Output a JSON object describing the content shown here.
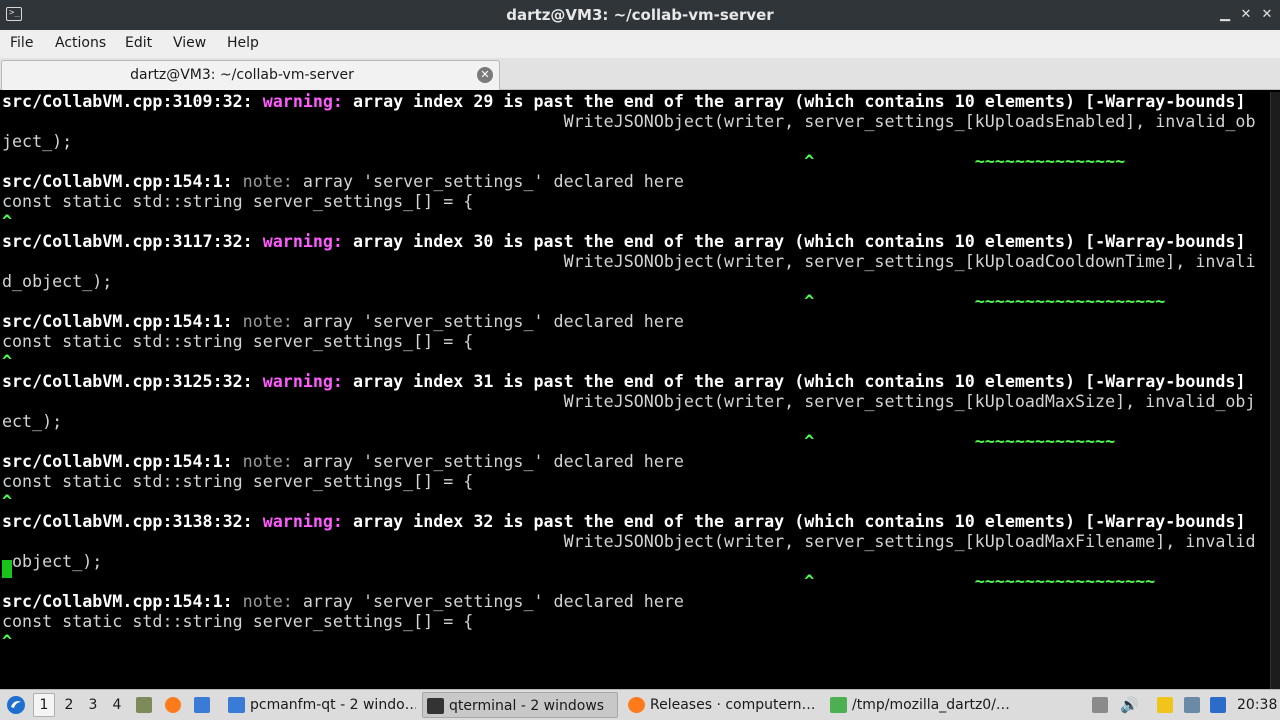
{
  "window": {
    "title": "dartz@VM3: ~/collab-vm-server",
    "app_icon": "terminal-icon",
    "controls": {
      "minimize": "–",
      "maximize": "✕",
      "close": "✕"
    }
  },
  "menu": {
    "file": "File",
    "actions": "Actions",
    "edit": "Edit",
    "view": "View",
    "help": "Help"
  },
  "tab": {
    "label": "dartz@VM3: ~/collab-vm-server",
    "close_glyph": "✕"
  },
  "terminal": {
    "lines": [
      {
        "segments": [
          {
            "c": "b",
            "t": "src/CollabVM.cpp:3109:32: "
          },
          {
            "c": "w",
            "t": "warning: "
          },
          {
            "c": "b",
            "t": "array index 29 is past the end of the array (which contains 10 elements) [-Warray-bounds]"
          }
        ]
      },
      {
        "segments": [
          {
            "c": "",
            "t": "                                                        WriteJSONObject(writer, server_settings_[kUploadsEnabled], invalid_ob"
          }
        ]
      },
      {
        "segments": [
          {
            "c": "",
            "t": "ject_);"
          }
        ]
      },
      {
        "segments": [
          {
            "c": "g",
            "t": "                                                                                ^                ~~~~~~~~~~~~~~~"
          }
        ]
      },
      {
        "segments": [
          {
            "c": "b",
            "t": "src/CollabVM.cpp:154:1: "
          },
          {
            "c": "n",
            "t": "note: "
          },
          {
            "c": "",
            "t": "array 'server_settings_' declared here"
          }
        ]
      },
      {
        "segments": [
          {
            "c": "",
            "t": "const static std::string server_settings_[] = {"
          }
        ]
      },
      {
        "segments": [
          {
            "c": "g",
            "t": "^"
          }
        ]
      },
      {
        "segments": [
          {
            "c": "b",
            "t": "src/CollabVM.cpp:3117:32: "
          },
          {
            "c": "w",
            "t": "warning: "
          },
          {
            "c": "b",
            "t": "array index 30 is past the end of the array (which contains 10 elements) [-Warray-bounds]"
          }
        ]
      },
      {
        "segments": [
          {
            "c": "",
            "t": "                                                        WriteJSONObject(writer, server_settings_[kUploadCooldownTime], invali"
          }
        ]
      },
      {
        "segments": [
          {
            "c": "",
            "t": "d_object_);"
          }
        ]
      },
      {
        "segments": [
          {
            "c": "g",
            "t": "                                                                                ^                ~~~~~~~~~~~~~~~~~~~"
          }
        ]
      },
      {
        "segments": [
          {
            "c": "b",
            "t": "src/CollabVM.cpp:154:1: "
          },
          {
            "c": "n",
            "t": "note: "
          },
          {
            "c": "",
            "t": "array 'server_settings_' declared here"
          }
        ]
      },
      {
        "segments": [
          {
            "c": "",
            "t": "const static std::string server_settings_[] = {"
          }
        ]
      },
      {
        "segments": [
          {
            "c": "g",
            "t": "^"
          }
        ]
      },
      {
        "segments": [
          {
            "c": "b",
            "t": "src/CollabVM.cpp:3125:32: "
          },
          {
            "c": "w",
            "t": "warning: "
          },
          {
            "c": "b",
            "t": "array index 31 is past the end of the array (which contains 10 elements) [-Warray-bounds]"
          }
        ]
      },
      {
        "segments": [
          {
            "c": "",
            "t": "                                                        WriteJSONObject(writer, server_settings_[kUploadMaxSize], invalid_obj"
          }
        ]
      },
      {
        "segments": [
          {
            "c": "",
            "t": "ect_);"
          }
        ]
      },
      {
        "segments": [
          {
            "c": "g",
            "t": "                                                                                ^                ~~~~~~~~~~~~~~"
          }
        ]
      },
      {
        "segments": [
          {
            "c": "b",
            "t": "src/CollabVM.cpp:154:1: "
          },
          {
            "c": "n",
            "t": "note: "
          },
          {
            "c": "",
            "t": "array 'server_settings_' declared here"
          }
        ]
      },
      {
        "segments": [
          {
            "c": "",
            "t": "const static std::string server_settings_[] = {"
          }
        ]
      },
      {
        "segments": [
          {
            "c": "g",
            "t": "^"
          }
        ]
      },
      {
        "segments": [
          {
            "c": "b",
            "t": "src/CollabVM.cpp:3138:32: "
          },
          {
            "c": "w",
            "t": "warning: "
          },
          {
            "c": "b",
            "t": "array index 32 is past the end of the array (which contains 10 elements) [-Warray-bounds]"
          }
        ]
      },
      {
        "segments": [
          {
            "c": "",
            "t": "                                                        WriteJSONObject(writer, server_settings_[kUploadMaxFilename], invalid"
          }
        ]
      },
      {
        "segments": [
          {
            "c": "",
            "t": "_object_);"
          }
        ]
      },
      {
        "segments": [
          {
            "c": "g",
            "t": "                                                                                ^                ~~~~~~~~~~~~~~~~~~"
          }
        ]
      },
      {
        "segments": [
          {
            "c": "b",
            "t": "src/CollabVM.cpp:154:1: "
          },
          {
            "c": "n",
            "t": "note: "
          },
          {
            "c": "",
            "t": "array 'server_settings_' declared here"
          }
        ]
      },
      {
        "segments": [
          {
            "c": "",
            "t": "const static std::string server_settings_[] = {"
          }
        ]
      },
      {
        "segments": [
          {
            "c": "g",
            "t": "^"
          }
        ]
      }
    ]
  },
  "taskbar": {
    "workspaces": [
      "1",
      "2",
      "3",
      "4"
    ],
    "tasks": {
      "pcmanfm": "pcmanfm-qt - 2 windo…",
      "qterminal": "qterminal - 2 windows",
      "firefox": "Releases · computern…",
      "mozilla": "/tmp/mozilla_dartz0/…"
    },
    "clock": "20:38"
  },
  "colors": {
    "warning": "#ff5cff",
    "caret": "#4cff4c",
    "note": "#9a9a9a",
    "cursor": "#19c419"
  }
}
